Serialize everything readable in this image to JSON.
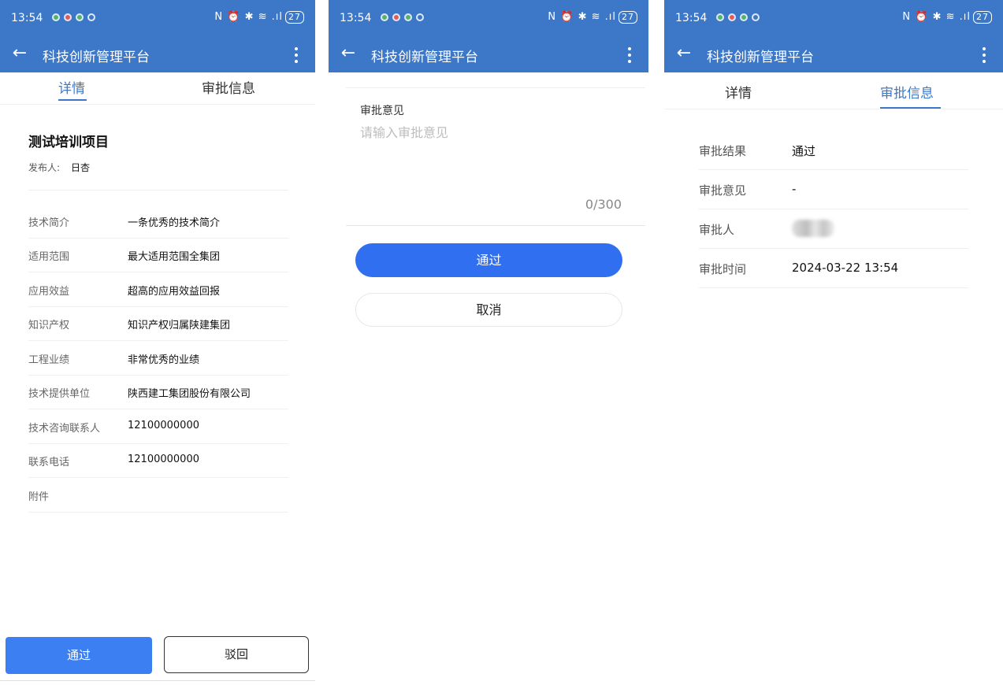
{
  "status_bar": {
    "time": "13:54",
    "right_icons": "N ⏰ ✱ ≋ .ıl",
    "battery": "27"
  },
  "app": {
    "title": "科技创新管理平台"
  },
  "colors": {
    "brand": "#3d77c8",
    "primary_button": "#3b7ff3"
  },
  "tabs": {
    "detail": "详情",
    "approval_info": "审批信息"
  },
  "screen1": {
    "project_title": "测试培训项目",
    "publisher_label": "发布人:",
    "publisher_value": "日杏",
    "fields": [
      {
        "label": "技术简介",
        "value": "一条优秀的技术简介"
      },
      {
        "label": "适用范围",
        "value": "最大适用范围全集团"
      },
      {
        "label": "应用效益",
        "value": "超高的应用效益回报"
      },
      {
        "label": "知识产权",
        "value": "知识产权归属陕建集团"
      },
      {
        "label": "工程业绩",
        "value": "非常优秀的业绩"
      },
      {
        "label": "技术提供单位",
        "value": "陕西建工集团股份有限公司"
      },
      {
        "label": "技术咨询联系人",
        "value": "12100000000"
      },
      {
        "label": "联系电话",
        "value": "12100000000"
      },
      {
        "label": "附件",
        "value": ""
      }
    ],
    "approve_button": "通过",
    "reject_button": "驳回"
  },
  "screen2": {
    "opinion_label": "审批意见",
    "opinion_placeholder": "请输入审批意见",
    "counter": "0/300",
    "approve_button": "通过",
    "cancel_button": "取消"
  },
  "screen3": {
    "rows": [
      {
        "label": "审批结果",
        "value": "通过"
      },
      {
        "label": "审批意见",
        "value": "-"
      },
      {
        "label": "审批人",
        "value": ""
      },
      {
        "label": "审批时间",
        "value": "2024-03-22 13:54"
      }
    ]
  }
}
